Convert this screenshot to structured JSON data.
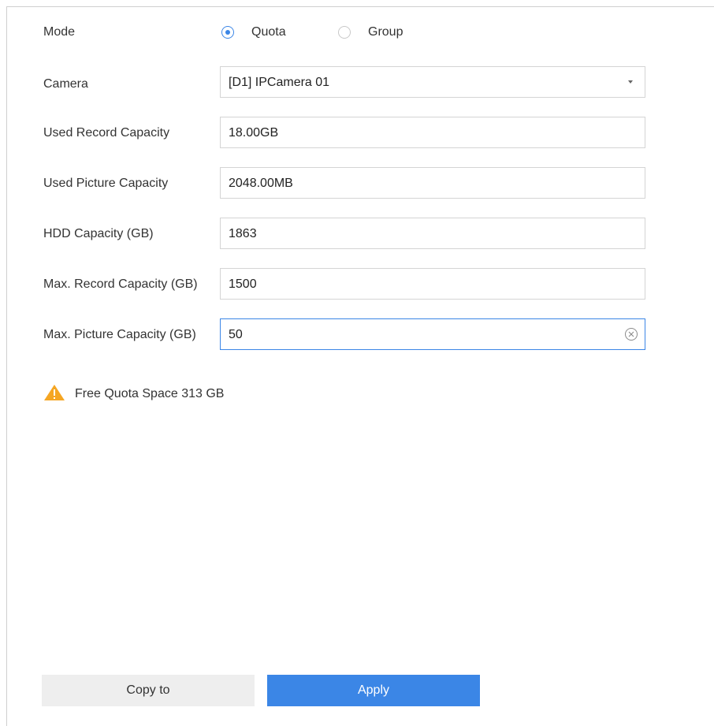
{
  "mode": {
    "label": "Mode",
    "options": [
      {
        "label": "Quota",
        "checked": true
      },
      {
        "label": "Group",
        "checked": false
      }
    ]
  },
  "camera": {
    "label": "Camera",
    "value": "[D1] IPCamera 01"
  },
  "used_record": {
    "label": "Used Record Capacity",
    "value": "18.00GB"
  },
  "used_picture": {
    "label": "Used Picture Capacity",
    "value": "2048.00MB"
  },
  "hdd_capacity": {
    "label": "HDD Capacity (GB)",
    "value": "1863"
  },
  "max_record": {
    "label": "Max. Record Capacity (GB)",
    "value": "1500"
  },
  "max_picture": {
    "label": "Max. Picture Capacity (GB)",
    "value": "50"
  },
  "warning": {
    "icon": "warning-icon",
    "text": "Free Quota Space 313 GB",
    "color": "#f5a623"
  },
  "buttons": {
    "copy_label": "Copy to",
    "apply_label": "Apply"
  },
  "colors": {
    "accent": "#3b86e6",
    "secondary_button": "#eeeeee"
  }
}
